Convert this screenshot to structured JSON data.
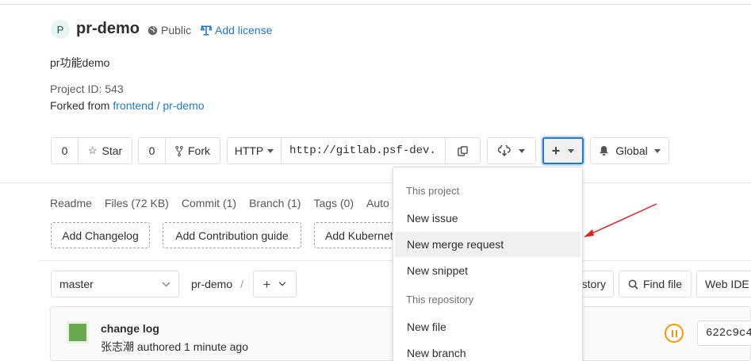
{
  "project": {
    "avatar_letter": "P",
    "name": "pr-demo",
    "visibility": "Public",
    "add_license": "Add license",
    "description": "pr功能demo",
    "project_id": "Project ID: 543",
    "forked_from_prefix": "Forked from ",
    "forked_from_link": "frontend / pr-demo"
  },
  "actions": {
    "star_count": "0",
    "star_label": "Star",
    "fork_count": "0",
    "fork_label": "Fork",
    "protocol": "HTTP",
    "clone_url": "http://gitlab.psf-dev.",
    "notification": "Global"
  },
  "stats": [
    "Readme",
    "Files (72 KB)",
    "Commit (1)",
    "Branch (1)",
    "Tags (0)",
    "Auto"
  ],
  "quick_add": {
    "changelog": "Add Changelog",
    "contribution": "Add Contribution guide",
    "kubernetes": "Add Kubernetes"
  },
  "repo_nav": {
    "branch": "master",
    "path": "pr-demo",
    "path_sep": "/",
    "history": "History",
    "find_file": "Find file",
    "web_ide": "Web IDE"
  },
  "commit": {
    "title": "change log",
    "author_line": "张志潮 authored 1 minute ago",
    "sha": "622c9c4"
  },
  "dropdown": {
    "section1": "This project",
    "items1": [
      "New issue",
      "New merge request",
      "New snippet"
    ],
    "section2": "This repository",
    "items2": [
      "New file",
      "New branch"
    ]
  },
  "colors": {
    "link": "#1f78d1",
    "arrow": "#e02020",
    "pipeline_pending": "#fc9403",
    "commit_avatar": "#6aa84f"
  }
}
